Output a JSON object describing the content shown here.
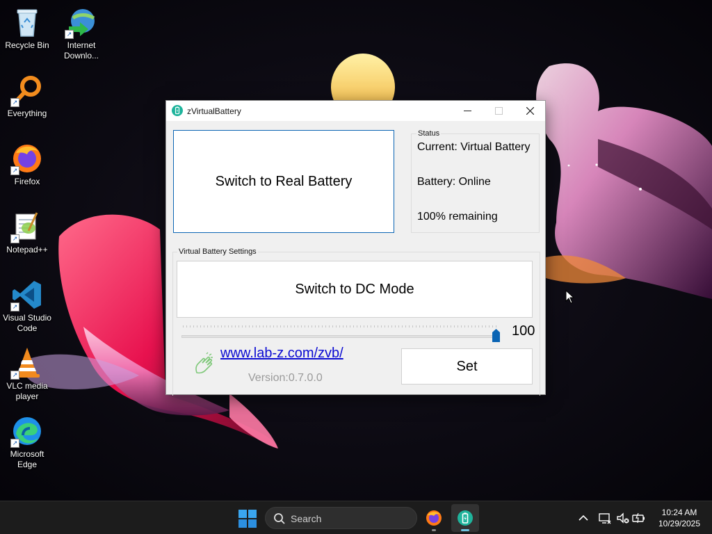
{
  "desktop": {
    "icons": [
      {
        "label_1": "Recycle Bin",
        "label_2": "",
        "icon": "recycle-bin-icon"
      },
      {
        "label_1": "Internet",
        "label_2": "Downlo...",
        "icon": "internet-download-manager-icon"
      },
      {
        "label_1": "Everything",
        "label_2": "",
        "icon": "everything-search-icon"
      },
      {
        "label_1": "Firefox",
        "label_2": "",
        "icon": "firefox-icon"
      },
      {
        "label_1": "Notepad++",
        "label_2": "",
        "icon": "notepad-plus-plus-icon"
      },
      {
        "label_1": "Visual Studio",
        "label_2": "Code",
        "icon": "vscode-icon"
      },
      {
        "label_1": "VLC media",
        "label_2": "player",
        "icon": "vlc-icon"
      },
      {
        "label_1": "Microsoft",
        "label_2": "Edge",
        "icon": "edge-icon"
      }
    ],
    "shortcut_glyph": "↗"
  },
  "window": {
    "title": "zVirtualBattery",
    "minimize_glyph": "—",
    "switch_battery_label": "Switch to Real Battery",
    "status": {
      "legend": "Status",
      "current": "Current: Virtual Battery",
      "battery": "Battery: Online",
      "remaining": "100% remaining"
    },
    "settings": {
      "legend": "Virtual Battery Settings",
      "dc_mode_label": "Switch to DC Mode",
      "slider_value": "100",
      "slider_fraction": 1.0,
      "link": "www.lab-z.com/zvb/",
      "version": "Version:0.7.0.0",
      "set_label": "Set"
    }
  },
  "taskbar": {
    "search_placeholder": "Search",
    "time": "10:24 AM",
    "date": "10/29/2025",
    "apps": [
      "firefox-icon",
      "zvirtualbattery-icon"
    ]
  },
  "colors": {
    "accent_blue": "#0a64b4",
    "link_blue": "#0a0ad2",
    "app_teal": "#1fb49c",
    "taskbar": "#1c1c1c"
  }
}
